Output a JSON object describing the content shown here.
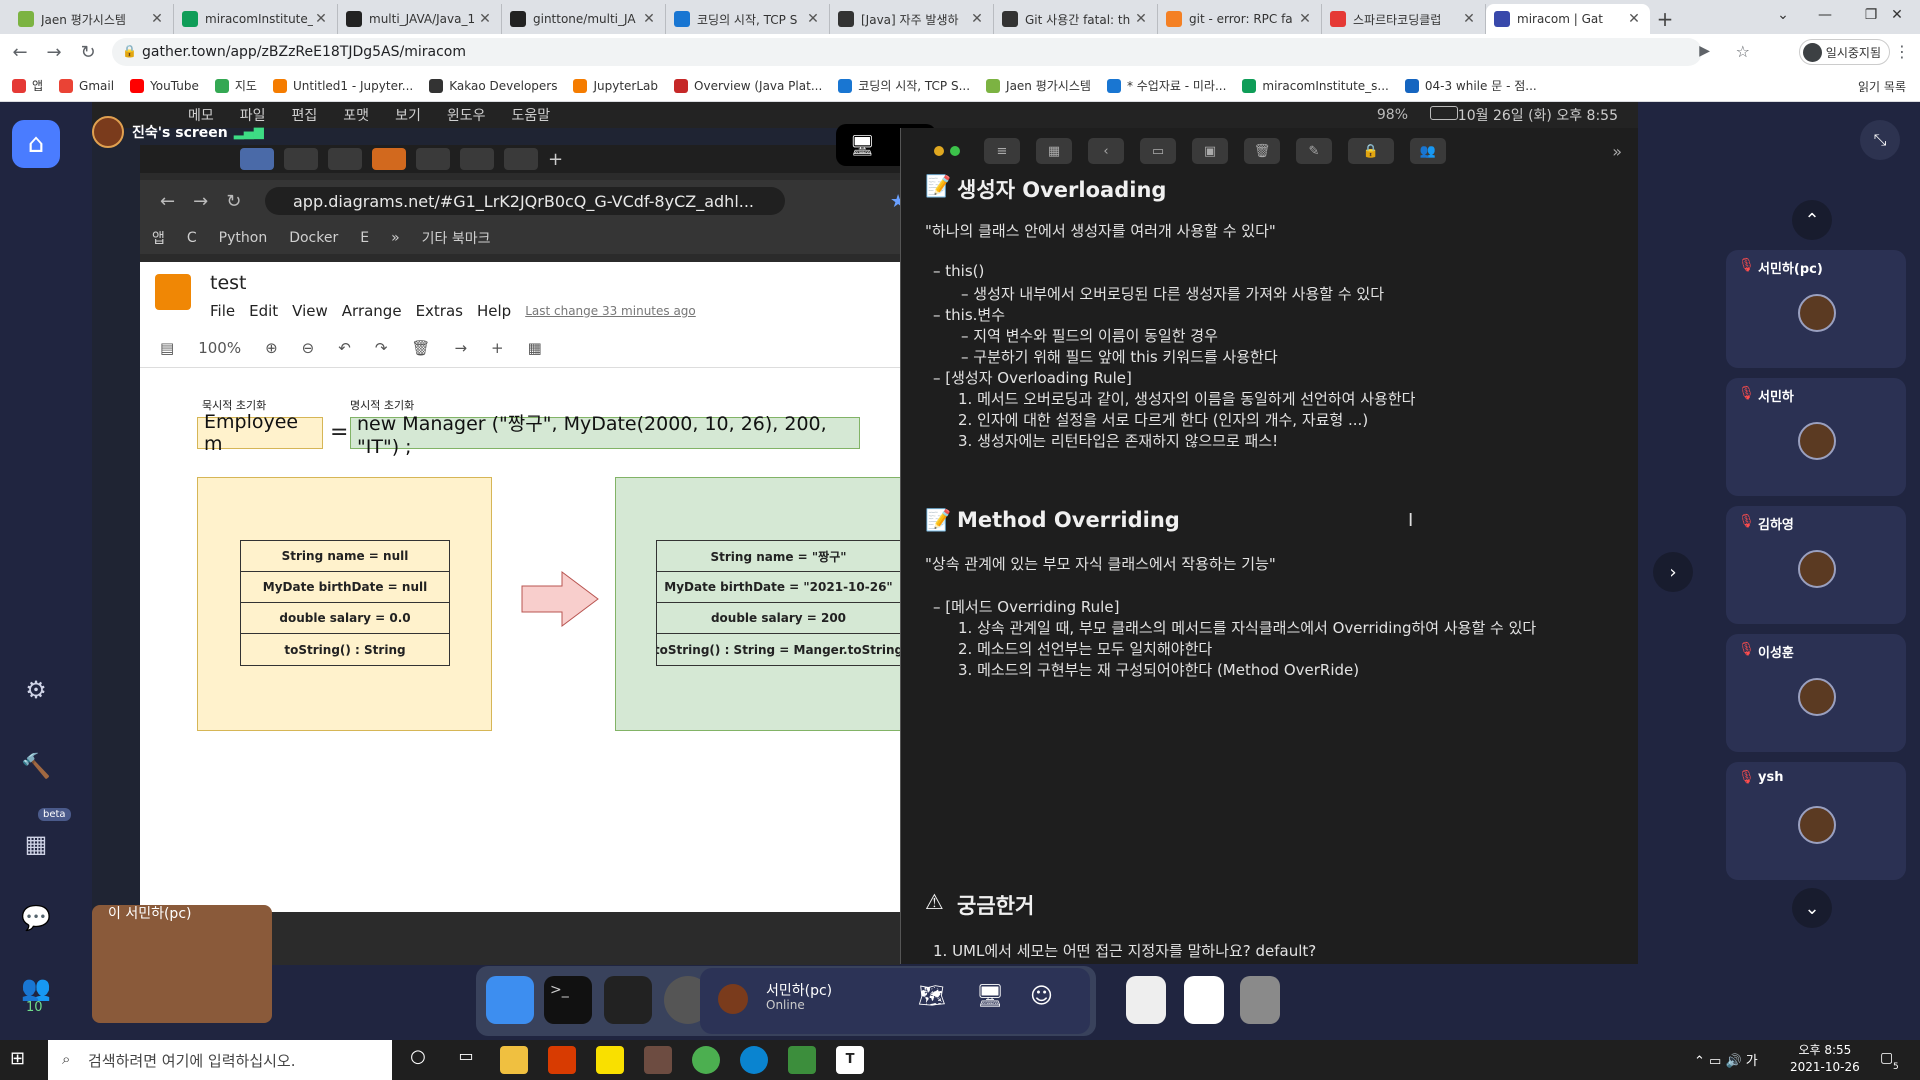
{
  "tabs": [
    {
      "label": "Jaen 평가시스템",
      "color": "#7cb342"
    },
    {
      "label": "miracomInstitute_",
      "color": "#0f9d58"
    },
    {
      "label": "multi_JAVA/Java_1",
      "color": "#222"
    },
    {
      "label": "ginttone/multi_JA",
      "color": "#222"
    },
    {
      "label": "코딩의 시작, TCP S",
      "color": "#1976d2"
    },
    {
      "label": "[Java] 자주 발생하",
      "color": "#333"
    },
    {
      "label": "Git 사용간 fatal: th",
      "color": "#333"
    },
    {
      "label": "git - error: RPC fa",
      "color": "#f48024"
    },
    {
      "label": "스파르타코딩클럽",
      "color": "#e53935"
    },
    {
      "label": "miracom | Gat",
      "color": "#3949ab",
      "active": true
    }
  ],
  "address": "gather.town/app/zBZzReE18TJDg5AS/miracom",
  "profile_label": "일시중지됨",
  "bookmarks": [
    "앱",
    "Gmail",
    "YouTube",
    "지도",
    "Untitled1 - Jupyter...",
    "Kakao Developers",
    "JupyterLab",
    "Overview (Java Plat...",
    "코딩의 시작, TCP S...",
    "Jaen 평가시스템",
    "* 수업자료 - 미라...",
    "miracomInstitute_s...",
    "04-3 while 문 - 점..."
  ],
  "reading_list": "읽기 목록",
  "mac_menu": [
    "메모",
    "파일",
    "편집",
    "포맷",
    "보기",
    "윈도우",
    "도움말"
  ],
  "mac_status": "10월 26일 (화) 오후 8:55",
  "mac_battery": "98%",
  "sharer_name": "진숙's screen",
  "inner": {
    "url": "app.diagrams.net/#G1_LrK2JQrB0cQ_G-VCdf-8yCZ_adhl...",
    "bookmarks": [
      "앱",
      "C",
      "Python",
      "Docker",
      "E",
      "»",
      "기타 북마크"
    ]
  },
  "drawio": {
    "title": "test",
    "menu": [
      "File",
      "Edit",
      "View",
      "Arrange",
      "Extras",
      "Help"
    ],
    "last_change": "Last change 33 minutes ago",
    "zoom": "100%",
    "implicit_label": "묵시적 초기화",
    "explicit_label": "명시적 초기화",
    "left_expr": "Employee  m",
    "equals": "=",
    "right_expr": "new Manager (\"짱구\", MyDate(2000, 10, 26), 200, \"IT\") ;",
    "left_box": [
      "String name = null",
      "MyDate birthDate = null",
      "double salary = 0.0",
      "toString() : String"
    ],
    "right_box": [
      "String name = \"짱구\"",
      "MyDate birthDate = \"2021-10-26\"",
      "double salary = 200",
      "toString() : String = Manger.toString"
    ]
  },
  "notes": {
    "h1": "생성자 Overloading",
    "q1": "\"하나의 클래스 안에서 생성자를 여러개 사용할 수 있다\"",
    "lines1": [
      "–  this()",
      "–  생성자 내부에서 오버로딩된 다른 생성자를 가져와 사용할 수 있다",
      "–  this.변수",
      "–  지역 변수와 필드의 이름이 동일한 경우",
      "–  구분하기 위해 필드 앞에 this 키워드를 사용한다",
      "–  [생성자 Overloading Rule]",
      "1. 메서드 오버로딩과 같이, 생성자의 이름을 동일하게 선언하여 사용한다",
      "2. 인자에 대한 설정을 서로 다르게 한다 (인자의 개수, 자료형 ...)",
      "3. 생성자에는 리턴타입은 존재하지 않으므로 패스!"
    ],
    "h2": "Method Overriding",
    "q2": "\"상속 관계에 있는 부모 자식 클래스에서 작용하는 기능\"",
    "lines2": [
      "–  [메서드 Overriding Rule]",
      "1. 상속 관계일 때, 부모 클래스의 메서드를 자식클래스에서 Overriding하여 사용할 수 있다",
      "2. 메소드의 선언부는 모두 일치해야한다",
      "3. 메소드의 구현부는 재 구성되어야한다 (Method OverRide)"
    ],
    "h3": "궁금한거",
    "lines3": [
      "1. UML에서 세모는 어떤 접근 지정자를 말하나요? default?"
    ]
  },
  "participants": [
    "서민하(pc)",
    "서민하",
    "김하영",
    "이성훈",
    "ysh"
  ],
  "self_name": "이 서민하(pc)",
  "beta": "beta",
  "people_count": "10",
  "gather_bar": {
    "name": "서민하(pc)",
    "status": "Online"
  },
  "taskbar": {
    "search_placeholder": "검색하려면 여기에 입력하십시오.",
    "time": "오후 8:55",
    "date": "2021-10-26",
    "badge": "5"
  }
}
